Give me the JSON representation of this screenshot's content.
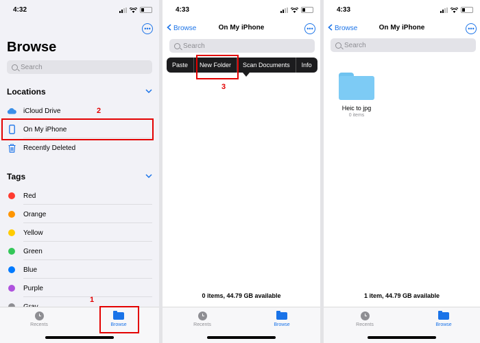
{
  "status": {
    "time": "4:32",
    "time2": "4:33",
    "time3": "4:33"
  },
  "more_glyph": "•••",
  "panel1": {
    "title": "Browse",
    "search_placeholder": "Search",
    "locations_header": "Locations",
    "locations": [
      {
        "label": "iCloud Drive",
        "icon": "cloud-icon"
      },
      {
        "label": "On My iPhone",
        "icon": "phone-icon"
      },
      {
        "label": "Recently Deleted",
        "icon": "trash-icon"
      }
    ],
    "tags_header": "Tags",
    "tags": [
      {
        "label": "Red",
        "color": "#ff3b30"
      },
      {
        "label": "Orange",
        "color": "#ff9500"
      },
      {
        "label": "Yellow",
        "color": "#ffcc00"
      },
      {
        "label": "Green",
        "color": "#34c759"
      },
      {
        "label": "Blue",
        "color": "#007aff"
      },
      {
        "label": "Purple",
        "color": "#af52de"
      },
      {
        "label": "Gray",
        "color": "#8e8e93"
      }
    ],
    "annotations": {
      "step1": "1",
      "step2": "2"
    }
  },
  "panel2": {
    "back": "Browse",
    "title": "On My iPhone",
    "search_placeholder": "Search",
    "context_menu": [
      "Paste",
      "New Folder",
      "Scan Documents",
      "Info"
    ],
    "footer": "0 items, 44.79 GB available",
    "annotation": "3"
  },
  "panel3": {
    "back": "Browse",
    "title": "On My iPhone",
    "search_placeholder": "Search",
    "folder_name": "Heic to jpg",
    "folder_items": "0 items",
    "footer": "1 item, 44.79 GB available"
  },
  "tabbar": {
    "recents": "Recents",
    "browse": "Browse"
  },
  "accent_color": "#1a73e8"
}
